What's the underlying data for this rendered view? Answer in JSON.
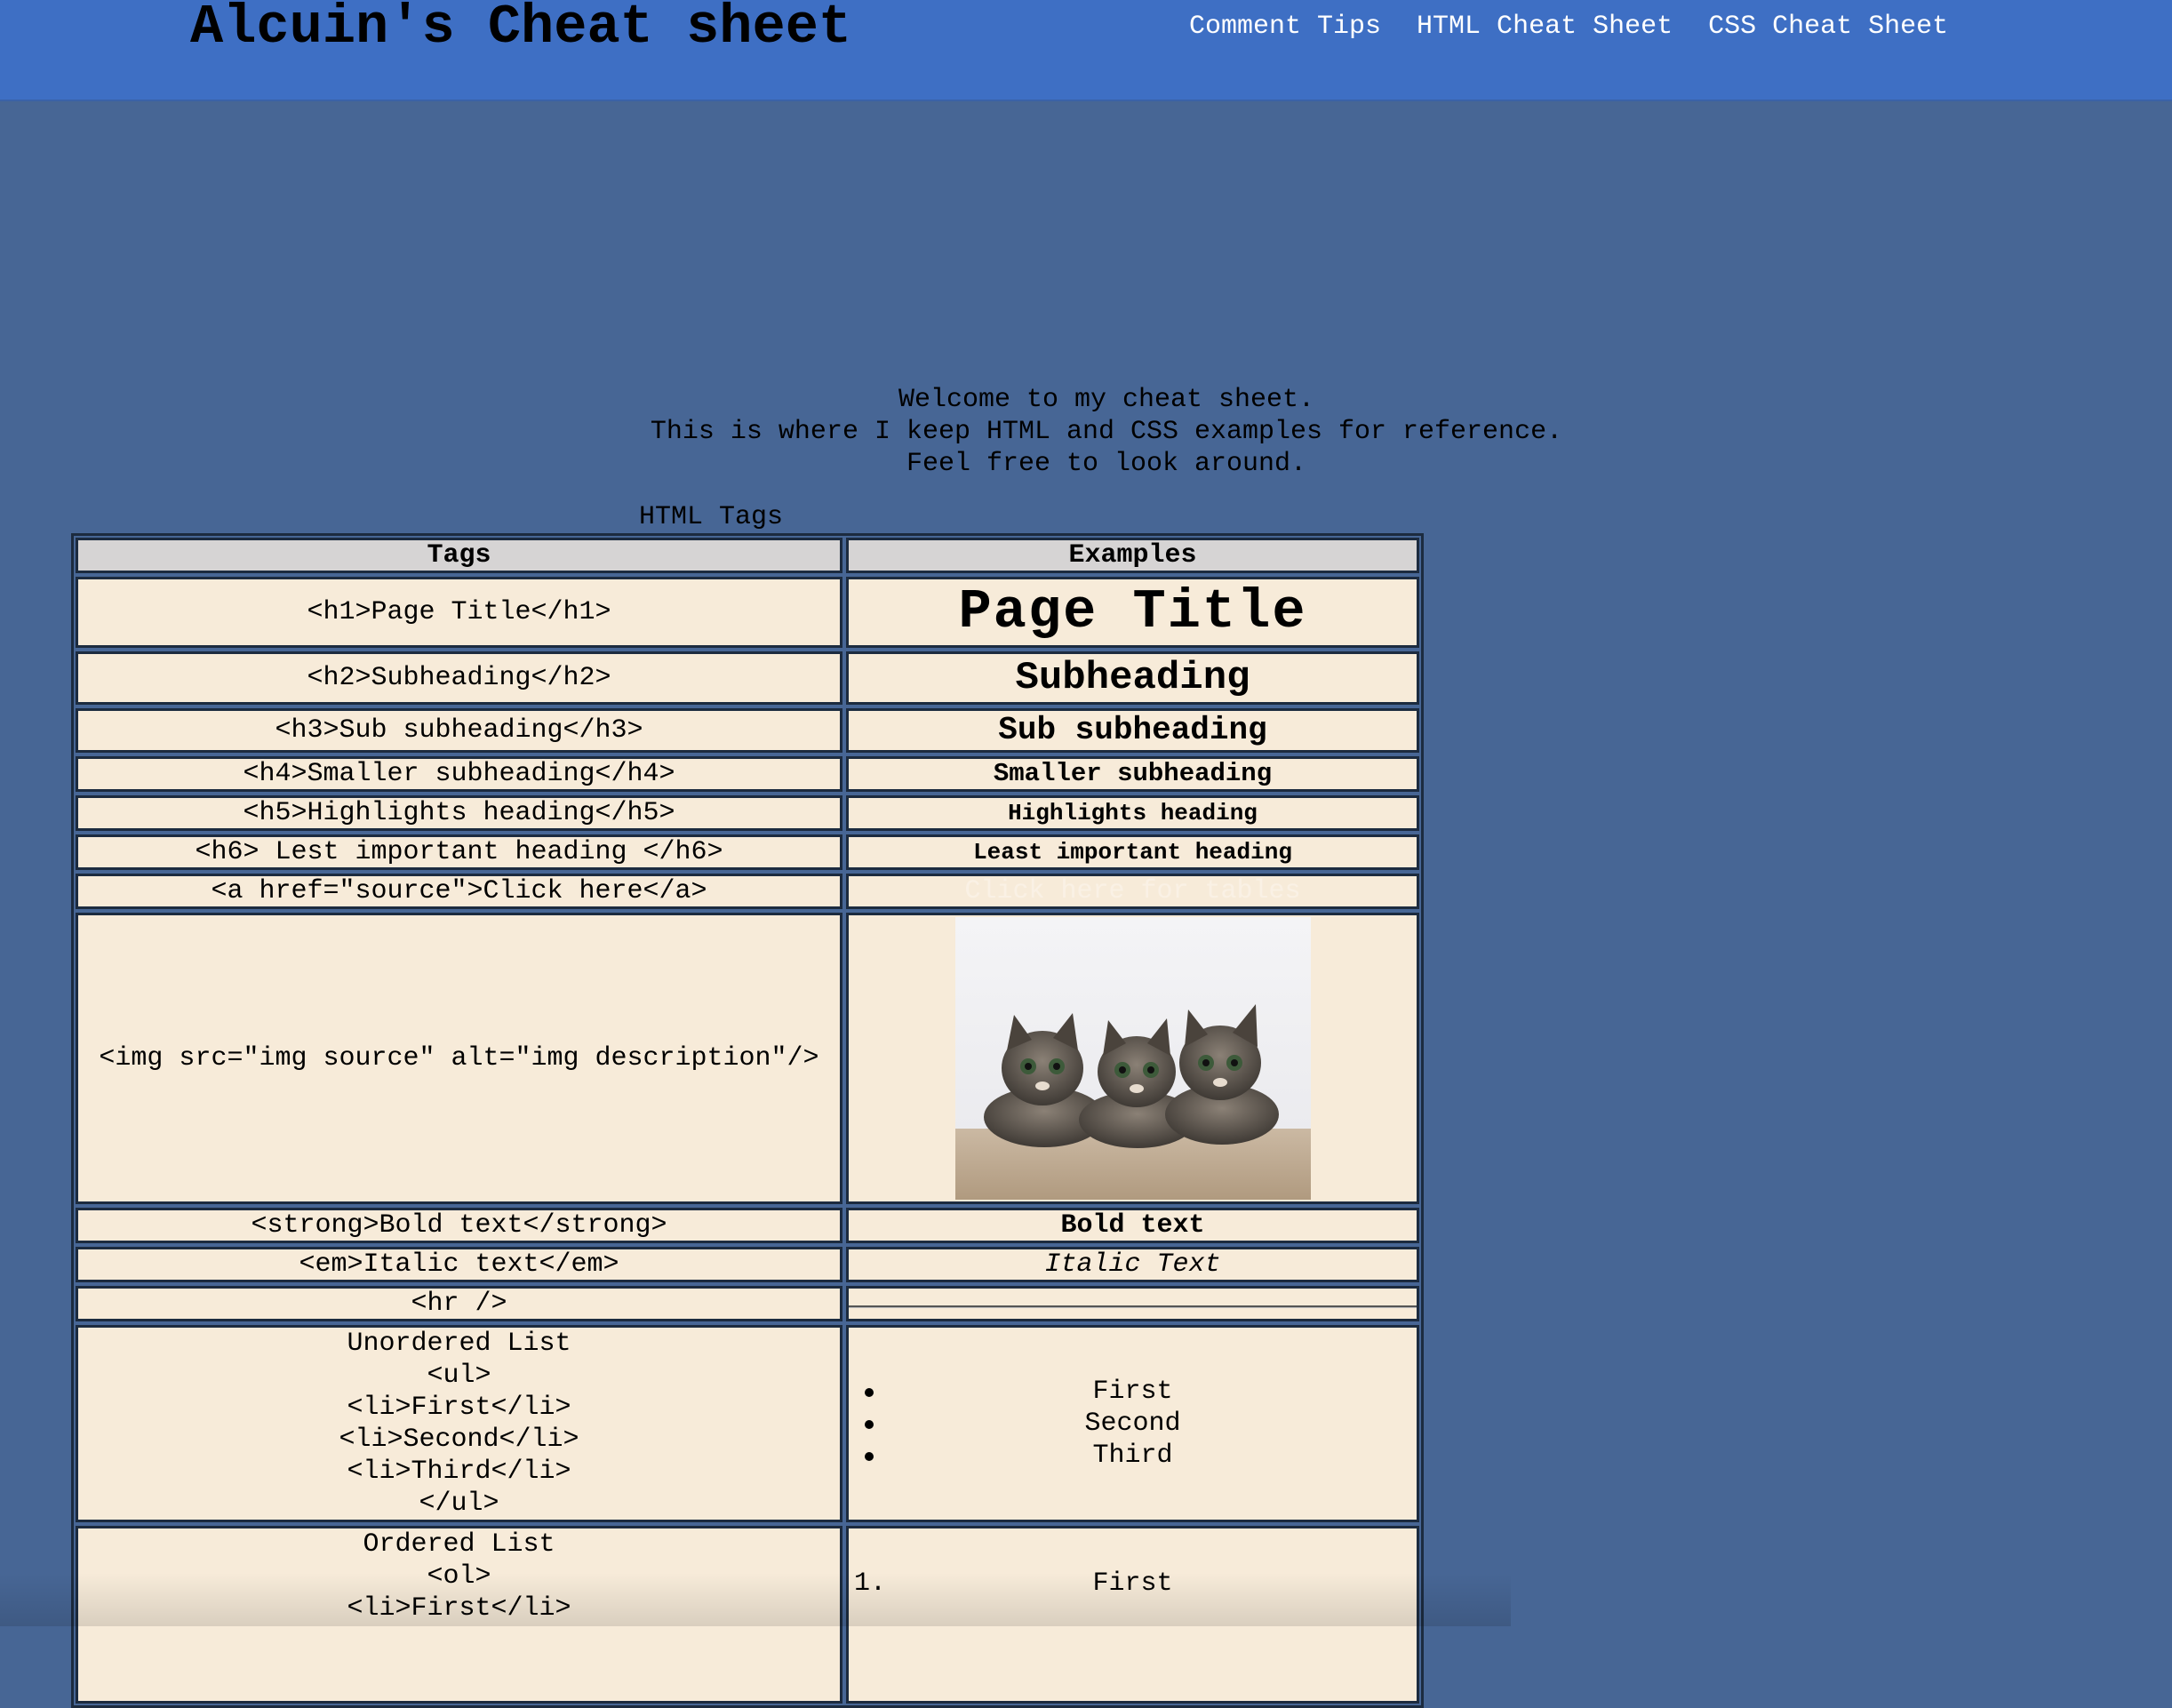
{
  "header": {
    "site_title": "Alcuin's Cheat sheet",
    "nav": [
      {
        "label": "Comment Tips"
      },
      {
        "label": "HTML Cheat Sheet"
      },
      {
        "label": "CSS Cheat Sheet"
      }
    ]
  },
  "colors": {
    "header_bg": "#3e6fc4",
    "page_bg": "#476695",
    "cell_bg": "#f7ebd9",
    "header_cell_bg": "#d6d4d4"
  },
  "welcome": {
    "lines": [
      "Welcome to my cheat sheet.",
      "This is where I keep HTML and CSS examples for reference.",
      "Feel free to look around."
    ]
  },
  "table": {
    "caption": "HTML Tags",
    "columns": [
      "Tags",
      "Examples"
    ],
    "rows": {
      "h1": {
        "tag": "<h1>Page Title</h1>",
        "example": "Page Title"
      },
      "h2": {
        "tag": "<h2>Subheading</h2>",
        "example": "Subheading"
      },
      "h3": {
        "tag": "<h3>Sub subheading</h3>",
        "example": "Sub subheading"
      },
      "h4": {
        "tag": "<h4>Smaller subheading</h4>",
        "example": "Smaller subheading"
      },
      "h5": {
        "tag": "<h5>Highlights heading</h5>",
        "example": "Highlights heading"
      },
      "h6": {
        "tag": "<h6> Lest important heading </h6>",
        "example": "Least important heading"
      },
      "a": {
        "tag": "<a href=\"source\">Click here</a>",
        "example": "Click here for tables"
      },
      "img": {
        "tag": "<img src=\"img source\" alt=\"img description\"/>",
        "example_icon": "kittens-photo"
      },
      "strong": {
        "tag": "<strong>Bold text</strong>",
        "example": "Bold text"
      },
      "em": {
        "tag": "<em>Italic text</em>",
        "example": "Italic Text"
      },
      "hr": {
        "tag": "<hr />"
      },
      "ul": {
        "tag_lines": [
          "Unordered List",
          "<ul>",
          "<li>First</li>",
          "<li>Second</li>",
          "<li>Third</li>",
          "</ul>"
        ],
        "items": [
          "First",
          "Second",
          "Third"
        ]
      },
      "ol": {
        "tag_lines": [
          "Ordered List",
          "<ol>",
          "<li>First</li>"
        ],
        "items": [
          {
            "num": "1.",
            "text": "First"
          }
        ]
      }
    }
  }
}
